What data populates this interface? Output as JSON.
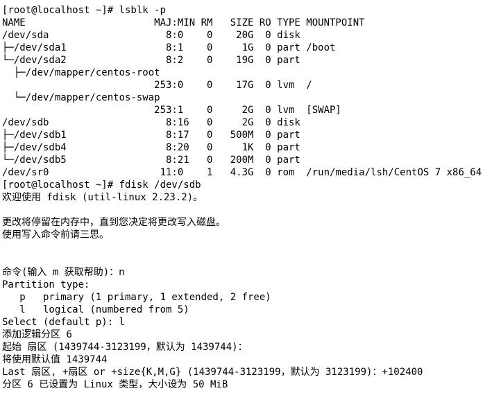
{
  "terminal": {
    "lines": [
      "[root@localhost ~]# lsblk -p",
      "NAME                      MAJ:MIN RM   SIZE RO TYPE MOUNTPOINT",
      "/dev/sda                    8:0    0    20G  0 disk",
      "├─/dev/sda1                 8:1    0     1G  0 part /boot",
      "└─/dev/sda2                 8:2    0    19G  0 part",
      "  ├─/dev/mapper/centos-root",
      "                          253:0    0    17G  0 lvm  /",
      "  └─/dev/mapper/centos-swap",
      "                          253:1    0     2G  0 lvm  [SWAP]",
      "/dev/sdb                    8:16   0     2G  0 disk",
      "├─/dev/sdb1                 8:17   0   500M  0 part",
      "├─/dev/sdb4                 8:20   0     1K  0 part",
      "└─/dev/sdb5                 8:21   0   200M  0 part",
      "/dev/sr0                   11:0    1   4.3G  0 rom  /run/media/lsh/CentOS 7 x86_64",
      "[root@localhost ~]# fdisk /dev/sdb",
      "欢迎使用 fdisk (util-linux 2.23.2)。",
      "",
      "更改将停留在内存中，直到您决定将更改写入磁盘。",
      "使用写入命令前请三思。",
      "",
      "",
      "命令(输入 m 获取帮助)：n",
      "Partition type:",
      "   p   primary (1 primary, 1 extended, 2 free)",
      "   l   logical (numbered from 5)",
      "Select (default p): l",
      "添加逻辑分区 6",
      "起始 扇区 (1439744-3123199，默认为 1439744)：",
      "将使用默认值 1439744",
      "Last 扇区, +扇区 or +size{K,M,G} (1439744-3123199，默认为 3123199)：+102400",
      "分区 6 已设置为 Linux 类型，大小设为 50 MiB"
    ]
  },
  "colors": {
    "background": "#ffffff",
    "text": "#000000"
  }
}
